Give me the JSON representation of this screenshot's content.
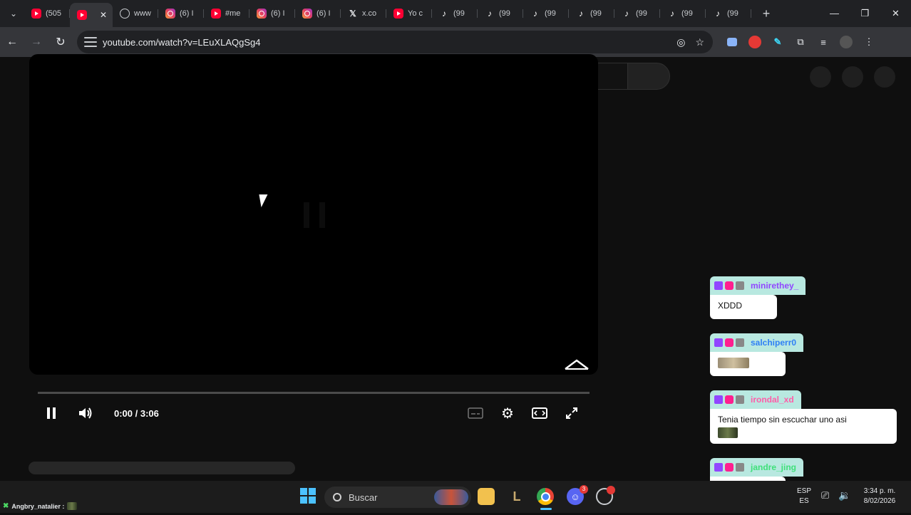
{
  "browser": {
    "tabs": [
      {
        "icon": "youtube-icon",
        "type": "yt",
        "label": "(505",
        "active": false
      },
      {
        "icon": "youtube-icon",
        "type": "yt",
        "label": "",
        "active": true,
        "close": "✕"
      },
      {
        "icon": "globe-icon",
        "type": "globe",
        "label": "www",
        "active": false
      },
      {
        "icon": "instagram-icon",
        "type": "ig",
        "label": "(6) I",
        "active": false
      },
      {
        "icon": "youtube-icon",
        "type": "yt",
        "label": "#me",
        "active": false
      },
      {
        "icon": "instagram-icon",
        "type": "ig",
        "label": "(6) I",
        "active": false
      },
      {
        "icon": "instagram-icon",
        "type": "ig",
        "label": "(6) I",
        "active": false
      },
      {
        "icon": "x-icon",
        "type": "x",
        "label": "x.co",
        "active": false
      },
      {
        "icon": "youtube-icon",
        "type": "yt",
        "label": "Yo c",
        "active": false
      },
      {
        "icon": "tiktok-icon",
        "type": "tt",
        "label": "(99",
        "active": false
      },
      {
        "icon": "tiktok-icon",
        "type": "tt",
        "label": "(99",
        "active": false
      },
      {
        "icon": "tiktok-icon",
        "type": "tt",
        "label": "(99",
        "active": false
      },
      {
        "icon": "tiktok-icon",
        "type": "tt",
        "label": "(99",
        "active": false
      },
      {
        "icon": "tiktok-icon",
        "type": "tt",
        "label": "(99",
        "active": false
      },
      {
        "icon": "tiktok-icon",
        "type": "tt",
        "label": "(99",
        "active": false
      },
      {
        "icon": "tiktok-icon",
        "type": "tt",
        "label": "(99",
        "active": false
      }
    ],
    "url": "youtube.com/watch?v=LEuXLAQgSg4"
  },
  "player": {
    "time": "0:00 / 3:06",
    "progress": 0
  },
  "chat": [
    {
      "user": "minirethey_",
      "color": "#9146ff",
      "head_bg": "#b8e8e0",
      "text": "XDDD",
      "emote": null
    },
    {
      "user": "salchiperr0",
      "color": "#2f7ff5",
      "head_bg": "#b8e8e0",
      "text": "",
      "emote": "light"
    },
    {
      "user": "irondal_xd",
      "color": "#ff5ca8",
      "head_bg": "#b8e8e0",
      "text": "Tenia tiempo sin escuchar uno asi",
      "emote": "dark"
    },
    {
      "user": "jandre_jing",
      "color": "#3fe07a",
      "head_bg": "#b8e8e0",
      "text": "",
      "emote": "light"
    }
  ],
  "taskbar": {
    "user": "Angbry_natalier :",
    "search_placeholder": "Buscar",
    "discord_badge": "3",
    "lang_top": "ESP",
    "lang_bottom": "ES",
    "time": "3:34 p. m.",
    "date": "8/02/2026"
  }
}
